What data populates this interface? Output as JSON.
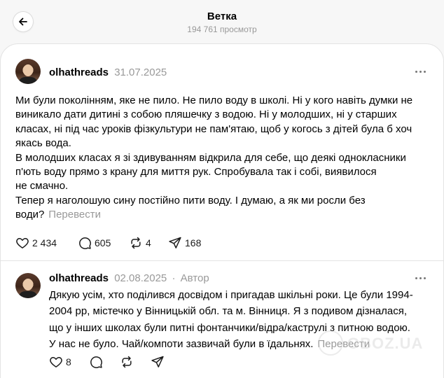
{
  "header": {
    "title": "Ветка",
    "views": "194 761 просмотр"
  },
  "post1": {
    "username": "olhathreads",
    "date": "31.07.2025",
    "lines": [
      "Ми були поколінням, яке не пило. Не пило воду в школі. Ні у кого навіть думки не",
      "виникало дати дитині з собою пляшечку з водою. Ні у молодших, ні у старших",
      "класах, ні під час уроків фізкультури не пам'ятаю, щоб у когось з дітей була б хоч",
      "якась вода.",
      "В молодших класах я зі здивуванням відкрила для себе, що деякі однокласники",
      "п'ють воду прямо з крану для миття рук. Спробувала так і собі, виявилося",
      "не смачно.",
      "Тепер я наголошую сину постійно пити воду. І думаю, а як ми росли без",
      "води?"
    ],
    "translate": "Перевести",
    "likes": "2 434",
    "comments": "605",
    "reposts": "4",
    "shares": "168"
  },
  "post2": {
    "username": "olhathreads",
    "date": "02.08.2025",
    "separator": "·",
    "author_label": "Автор",
    "lines": [
      "Дякую усім, хто поділився досвідом і пригадав шкільні роки. Це були 1994-",
      "2004 рр, містечко у Вінницькій обл. та м. Вінниця. Я з подивом дізналася,",
      "що у інших школах були питні фонтанчики/відра/каструлі з питною водою.",
      "У нас не було. Чай/компоти зазвичай були в їдальнях."
    ],
    "translate": "Перевести",
    "likes": "8"
  },
  "watermark": "OBOZ.UA",
  "colors": {
    "background": "#f7f7f7",
    "panel": "#ffffff",
    "muted": "#999999",
    "text": "#000000"
  }
}
